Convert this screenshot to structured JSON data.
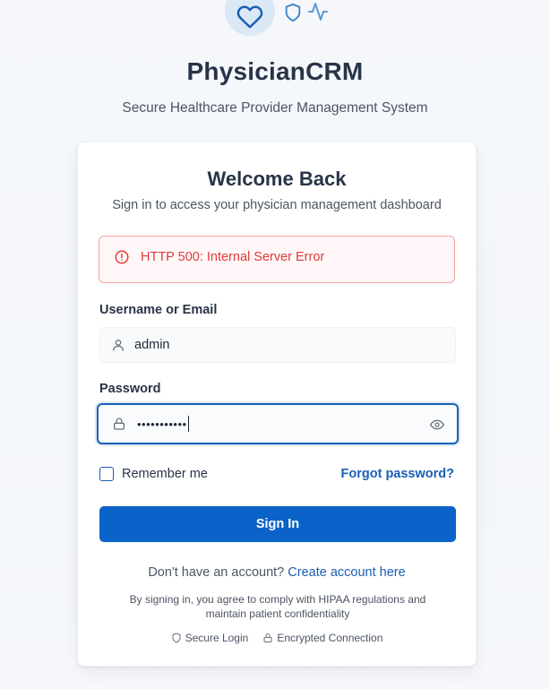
{
  "brand": {
    "title": "PhysicianCRM",
    "subtitle": "Secure Healthcare Provider Management System",
    "icons": [
      "heart-icon",
      "shield-icon",
      "activity-icon"
    ],
    "accent_color": "#0b63c9"
  },
  "card": {
    "title": "Welcome Back",
    "subtitle": "Sign in to access your physician management dashboard"
  },
  "error": {
    "icon": "alert-circle-icon",
    "message": "HTTP 500: Internal Server Error",
    "color": "#e03a3a"
  },
  "username": {
    "label": "Username or Email",
    "value": "admin",
    "icon": "user-icon"
  },
  "password": {
    "label": "Password",
    "masked_value": "•••••••••••",
    "icon": "lock-icon",
    "toggle_icon": "eye-icon"
  },
  "remember": {
    "label": "Remember me",
    "checked": false
  },
  "forgot_password": "Forgot password?",
  "sign_in_button": "Sign In",
  "signup": {
    "prompt": "Don't have an account?",
    "link": "Create account here"
  },
  "hipaa_notice": "By signing in, you agree to comply with HIPAA regulations and maintain patient confidentiality",
  "badges": [
    {
      "icon": "shield-icon",
      "label": "Secure Login"
    },
    {
      "icon": "lock-icon",
      "label": "Encrypted Connection"
    }
  ]
}
